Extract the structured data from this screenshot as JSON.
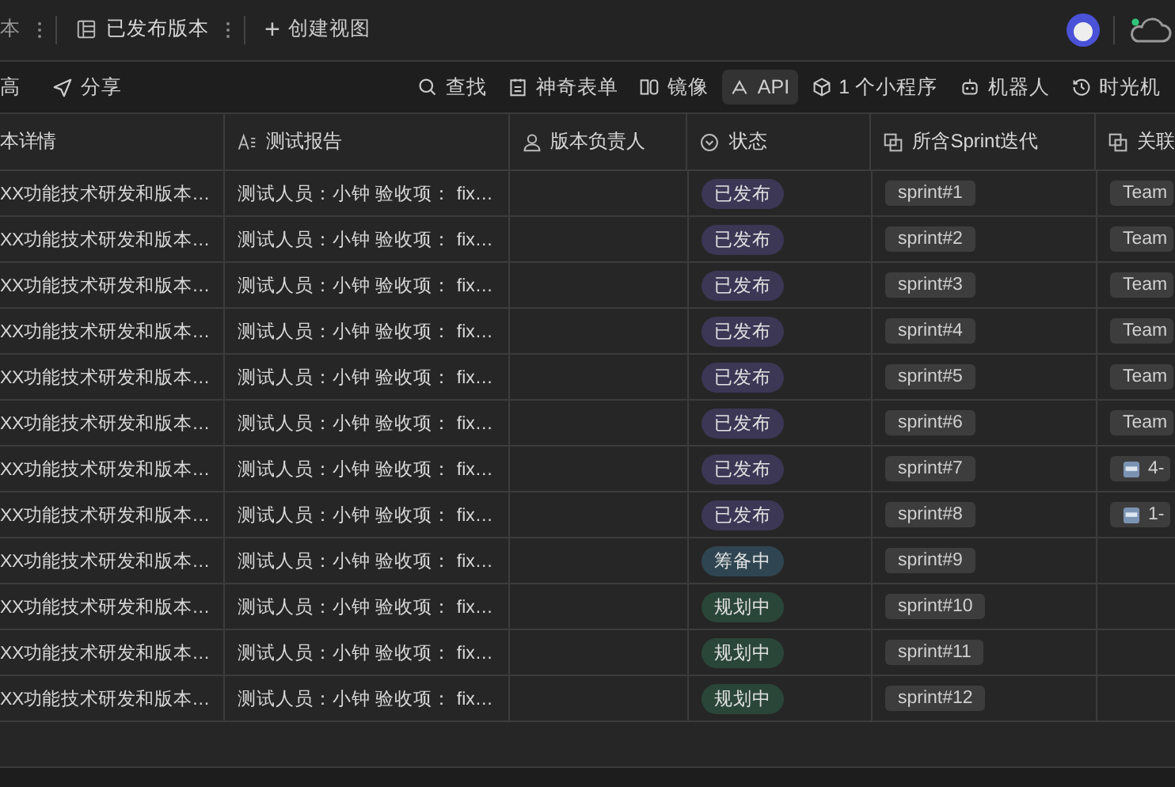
{
  "view_tabs": [
    {
      "label": "本",
      "selected": false
    },
    {
      "label": "已发布版本",
      "selected": true
    }
  ],
  "create_view": {
    "icon": "+",
    "label": "创建视图"
  },
  "toolbar_left": [
    {
      "label": "高",
      "kind": "text"
    },
    {
      "label": "分享",
      "kind": "share"
    }
  ],
  "toolbar_right": [
    {
      "label": "查找",
      "kind": "search",
      "highlighted": false
    },
    {
      "label": "神奇表单",
      "kind": "form",
      "highlighted": false
    },
    {
      "label": "镜像",
      "kind": "mirror",
      "highlighted": false
    },
    {
      "label": "API",
      "kind": "api",
      "highlighted": true
    },
    {
      "label": "1 个小程序",
      "kind": "app",
      "highlighted": false
    },
    {
      "label": "机器人",
      "kind": "robot",
      "highlighted": false
    },
    {
      "label": "时光机",
      "kind": "history",
      "highlighted": false
    }
  ],
  "table": {
    "columns": [
      {
        "label": "本详情",
        "kind": "none"
      },
      {
        "label": "测试报告",
        "kind": "text"
      },
      {
        "label": "版本负责人",
        "kind": "person"
      },
      {
        "label": "状态",
        "kind": "status"
      },
      {
        "label": "所含Sprint迭代",
        "kind": "link"
      },
      {
        "label": "关联",
        "kind": "link"
      }
    ],
    "rows": [
      {
        "detail": "XX功能技术研发和版本…",
        "report": "测试人员：小钟 验收项： fix…",
        "status": {
          "label": "已发布",
          "color": "#3b3755"
        },
        "sprint": "sprint#1",
        "related": {
          "label": "Team",
          "kind": "tag"
        }
      },
      {
        "detail": "XX功能技术研发和版本…",
        "report": "测试人员：小钟 验收项： fix…",
        "status": {
          "label": "已发布",
          "color": "#3b3755"
        },
        "sprint": "sprint#2",
        "related": {
          "label": "Team",
          "kind": "tag"
        }
      },
      {
        "detail": "XX功能技术研发和版本…",
        "report": "测试人员：小钟 验收项： fix…",
        "status": {
          "label": "已发布",
          "color": "#3b3755"
        },
        "sprint": "sprint#3",
        "related": {
          "label": "Team",
          "kind": "tag"
        }
      },
      {
        "detail": "XX功能技术研发和版本…",
        "report": "测试人员：小钟 验收项： fix…",
        "status": {
          "label": "已发布",
          "color": "#3b3755"
        },
        "sprint": "sprint#4",
        "related": {
          "label": "Team",
          "kind": "tag"
        }
      },
      {
        "detail": "XX功能技术研发和版本…",
        "report": "测试人员：小钟 验收项： fix…",
        "status": {
          "label": "已发布",
          "color": "#3b3755"
        },
        "sprint": "sprint#5",
        "related": {
          "label": "Team",
          "kind": "tag"
        }
      },
      {
        "detail": "XX功能技术研发和版本…",
        "report": "测试人员：小钟 验收项： fix…",
        "status": {
          "label": "已发布",
          "color": "#3b3755"
        },
        "sprint": "sprint#6",
        "related": {
          "label": "Team",
          "kind": "tag"
        }
      },
      {
        "detail": "XX功能技术研发和版本…",
        "report": "测试人员：小钟 验收项： fix…",
        "status": {
          "label": "已发布",
          "color": "#3b3755"
        },
        "sprint": "sprint#7",
        "related": {
          "label": "4-",
          "kind": "doc"
        }
      },
      {
        "detail": "XX功能技术研发和版本…",
        "report": "测试人员：小钟 验收项： fix…",
        "status": {
          "label": "已发布",
          "color": "#3b3755"
        },
        "sprint": "sprint#8",
        "related": {
          "label": "1-",
          "kind": "doc"
        }
      },
      {
        "detail": "XX功能技术研发和版本…",
        "report": "测试人员：小钟 验收项： fix…",
        "status": {
          "label": "筹备中",
          "color": "#2f4652"
        },
        "sprint": "sprint#9"
      },
      {
        "detail": "XX功能技术研发和版本…",
        "report": "测试人员：小钟 验收项： fix…",
        "status": {
          "label": "规划中",
          "color": "#2a4639"
        },
        "sprint": "sprint#10"
      },
      {
        "detail": "XX功能技术研发和版本…",
        "report": "测试人员：小钟 验收项： fix…",
        "status": {
          "label": "规划中",
          "color": "#2a4639"
        },
        "sprint": "sprint#11"
      },
      {
        "detail": "XX功能技术研发和版本…",
        "report": "测试人员：小钟 验收项： fix…",
        "status": {
          "label": "规划中",
          "color": "#2a4639"
        },
        "sprint": "sprint#12"
      }
    ]
  }
}
